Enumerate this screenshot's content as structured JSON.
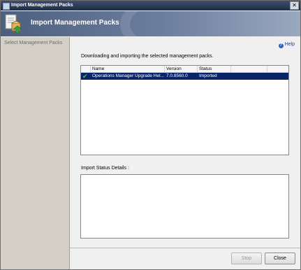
{
  "window": {
    "title": "Import Management Packs",
    "close_glyph": "✕"
  },
  "banner": {
    "title": "Import Management Packs",
    "icon": "management-pack-icon"
  },
  "nav": {
    "items": [
      {
        "label": "Select Management Packs"
      }
    ]
  },
  "main": {
    "help": {
      "label": "Help",
      "icon_glyph": "?"
    },
    "description": "Downloading and importing the selected management packs.",
    "list": {
      "columns": [
        "Name",
        "Version",
        "Status"
      ],
      "rows": [
        {
          "name": "Operations Manager Upgrade Hel...",
          "version": "7.0.8560.0",
          "status": "Imported",
          "selected": true,
          "icon": "check-icon"
        }
      ]
    },
    "status_details_label": "Import Status Details :",
    "status_details_text": ""
  },
  "buttons": {
    "stop": "Stop",
    "close": "Close"
  },
  "colors": {
    "selection": "#0a246a",
    "check": "#4fc04a",
    "banner": "#4c5f7f"
  }
}
